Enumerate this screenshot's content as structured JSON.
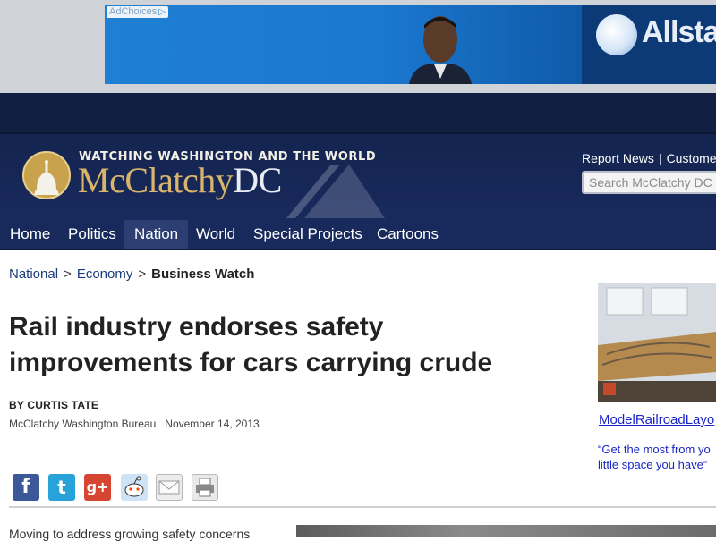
{
  "ad": {
    "choices_label": "AdChoices",
    "brand": "Allsta"
  },
  "header": {
    "tagline": "WATCHING WASHINGTON AND THE WORLD",
    "logo_main": "McClatchy",
    "logo_dc": "DC",
    "report_news": "Report News",
    "customer": "Customer S",
    "search_placeholder": "Search McClatchy DC"
  },
  "nav": {
    "items": [
      {
        "label": "Home"
      },
      {
        "label": "Politics"
      },
      {
        "label": "Nation"
      },
      {
        "label": "World"
      },
      {
        "label": "Special Projects"
      },
      {
        "label": "Cartoons"
      }
    ],
    "active": "Nation"
  },
  "breadcrumb": {
    "level1": "National",
    "level2": "Economy",
    "current": "Business Watch",
    "separator": ">"
  },
  "article": {
    "headline": "Rail industry endorses safety improvements for cars carrying crude",
    "byline": "BY CURTIS TATE",
    "bureau": "McClatchy Washington Bureau",
    "date": "November 14, 2013",
    "lede": "Moving to address growing safety concerns"
  },
  "share": {
    "facebook": "f",
    "twitter": "t",
    "googleplus": "g+"
  },
  "sidebar": {
    "link": "ModelRailroadLayo",
    "quote_line1": "“Get the most from yo",
    "quote_line2": "little space you have”"
  },
  "colors": {
    "masthead": "#182a5c",
    "logo_gold": "#d9b46a",
    "link_blue": "#1a25c9"
  }
}
